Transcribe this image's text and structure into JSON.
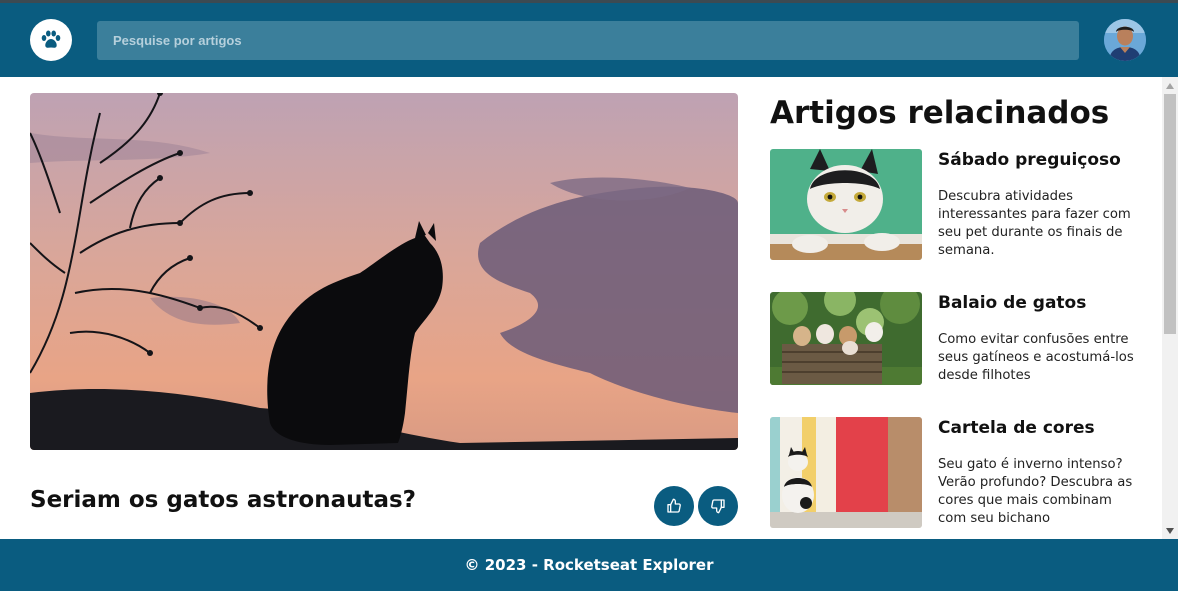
{
  "header": {
    "search_placeholder": "Pesquise por artigos",
    "logo_icon": "paw-icon",
    "avatar_icon": "user-avatar"
  },
  "article": {
    "title": "Seriam os gatos astronautas?",
    "hero_image": "cat-silhouette-sunset",
    "like_icon": "thumbs-up-icon",
    "dislike_icon": "thumbs-down-icon"
  },
  "related": {
    "heading": "Artigos relacinados",
    "items": [
      {
        "title": "Sábado preguiçoso",
        "description": "Descubra atividades interessantes para fazer com seu pet durante os finais de semana.",
        "image": "black-white-cat-green-background"
      },
      {
        "title": "Balaio de gatos",
        "description": "Como evitar confusões entre seus gatíneos e acostumá-los desde filhotes",
        "image": "kittens-in-basket"
      },
      {
        "title": "Cartela de cores",
        "description": "Seu gato é inverno intenso? Verão profundo? Descubra as cores que mais combinam com seu bichano",
        "image": "cat-colorful-wall"
      }
    ]
  },
  "footer": {
    "text": "© 2023 - Rocketseat Explorer"
  },
  "colors": {
    "primary": "#0a5c80",
    "search_bg": "#3b7f9b"
  }
}
